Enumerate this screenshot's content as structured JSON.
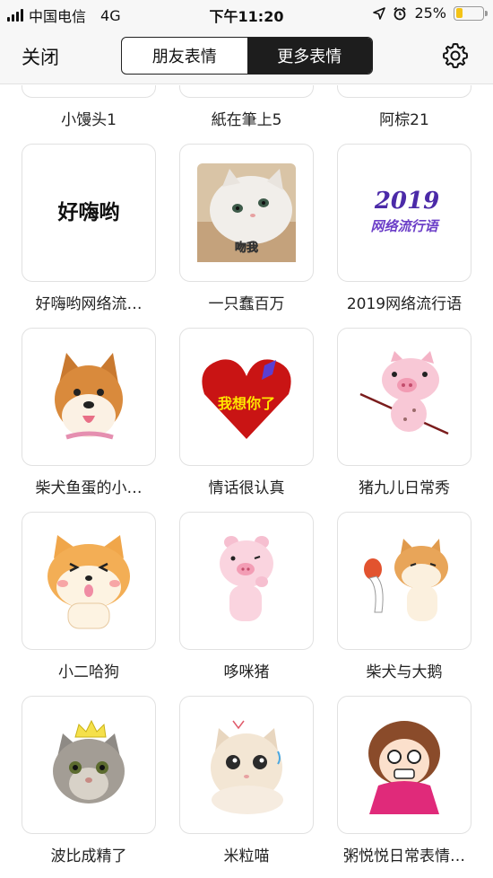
{
  "status_bar": {
    "carrier": "中国电信",
    "network": "4G",
    "time": "下午11:20",
    "battery": "25%",
    "battery_level": 0.25,
    "battery_color": "#f4c316",
    "icons": [
      "signal-icon",
      "location-arrow-icon",
      "alarm-icon",
      "battery-icon"
    ]
  },
  "nav": {
    "close_label": "关闭",
    "tabs": [
      {
        "label": "朋友表情",
        "active": false
      },
      {
        "label": "更多表情",
        "active": true
      }
    ],
    "settings_icon": "gear-icon"
  },
  "grid": {
    "top_row_labels": [
      "小馒头1",
      "紙在筆上5",
      "阿棕21"
    ],
    "items": [
      {
        "label": "好嗨哟网络流…",
        "art_text": "好嗨哟",
        "icon": "haohaiyo-sticker"
      },
      {
        "label": "一只蠢百万",
        "art_text": "吻我",
        "icon": "white-cat-sticker"
      },
      {
        "label": "2019网络流行语",
        "art_text": "2019",
        "art_subtext": "网络流行语",
        "icon": "slang-2019-sticker"
      },
      {
        "label": "柴犬鱼蛋的小…",
        "icon": "shiba-dog-sticker"
      },
      {
        "label": "情话很认真",
        "art_text": "我想你了",
        "icon": "heart-butterfly-sticker"
      },
      {
        "label": "猪九儿日常秀",
        "icon": "pink-pig-sticker"
      },
      {
        "label": "小二哈狗",
        "icon": "cartoon-shiba-sticker"
      },
      {
        "label": "哆咪猪",
        "icon": "thinking-pig-sticker"
      },
      {
        "label": "柴犬与大鹅",
        "icon": "shiba-goose-sticker"
      },
      {
        "label": "波比成精了",
        "icon": "crown-cat-sticker"
      },
      {
        "label": "米粒喵",
        "icon": "scared-kitten-sticker"
      },
      {
        "label": "粥悦悦日常表情…",
        "icon": "cartoon-girl-sticker"
      }
    ]
  }
}
